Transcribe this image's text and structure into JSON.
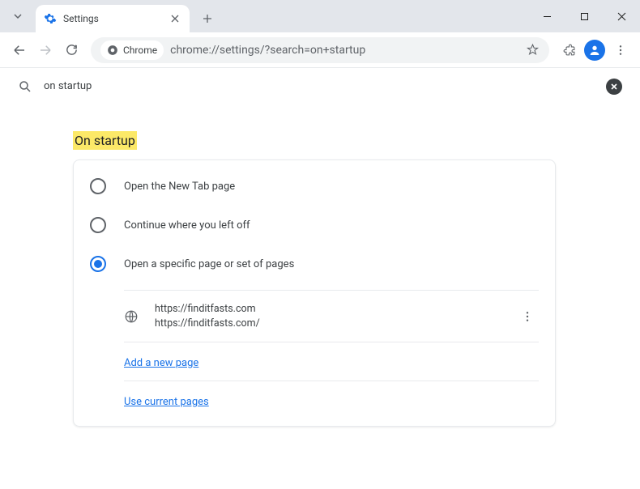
{
  "window": {
    "tab_title": "Settings"
  },
  "addressbar": {
    "chrome_label": "Chrome",
    "url": "chrome://settings/?search=on+startup"
  },
  "search": {
    "query": "on startup"
  },
  "section": {
    "title": "On startup",
    "radios": [
      {
        "label": "Open the New Tab page",
        "selected": false
      },
      {
        "label": "Continue where you left off",
        "selected": false
      },
      {
        "label": "Open a specific page or set of pages",
        "selected": true
      }
    ],
    "startup_page": {
      "line1": "https://finditfasts.com",
      "line2": "https://finditfasts.com/"
    },
    "add_link": "Add a new page",
    "use_current_link": "Use current pages"
  }
}
